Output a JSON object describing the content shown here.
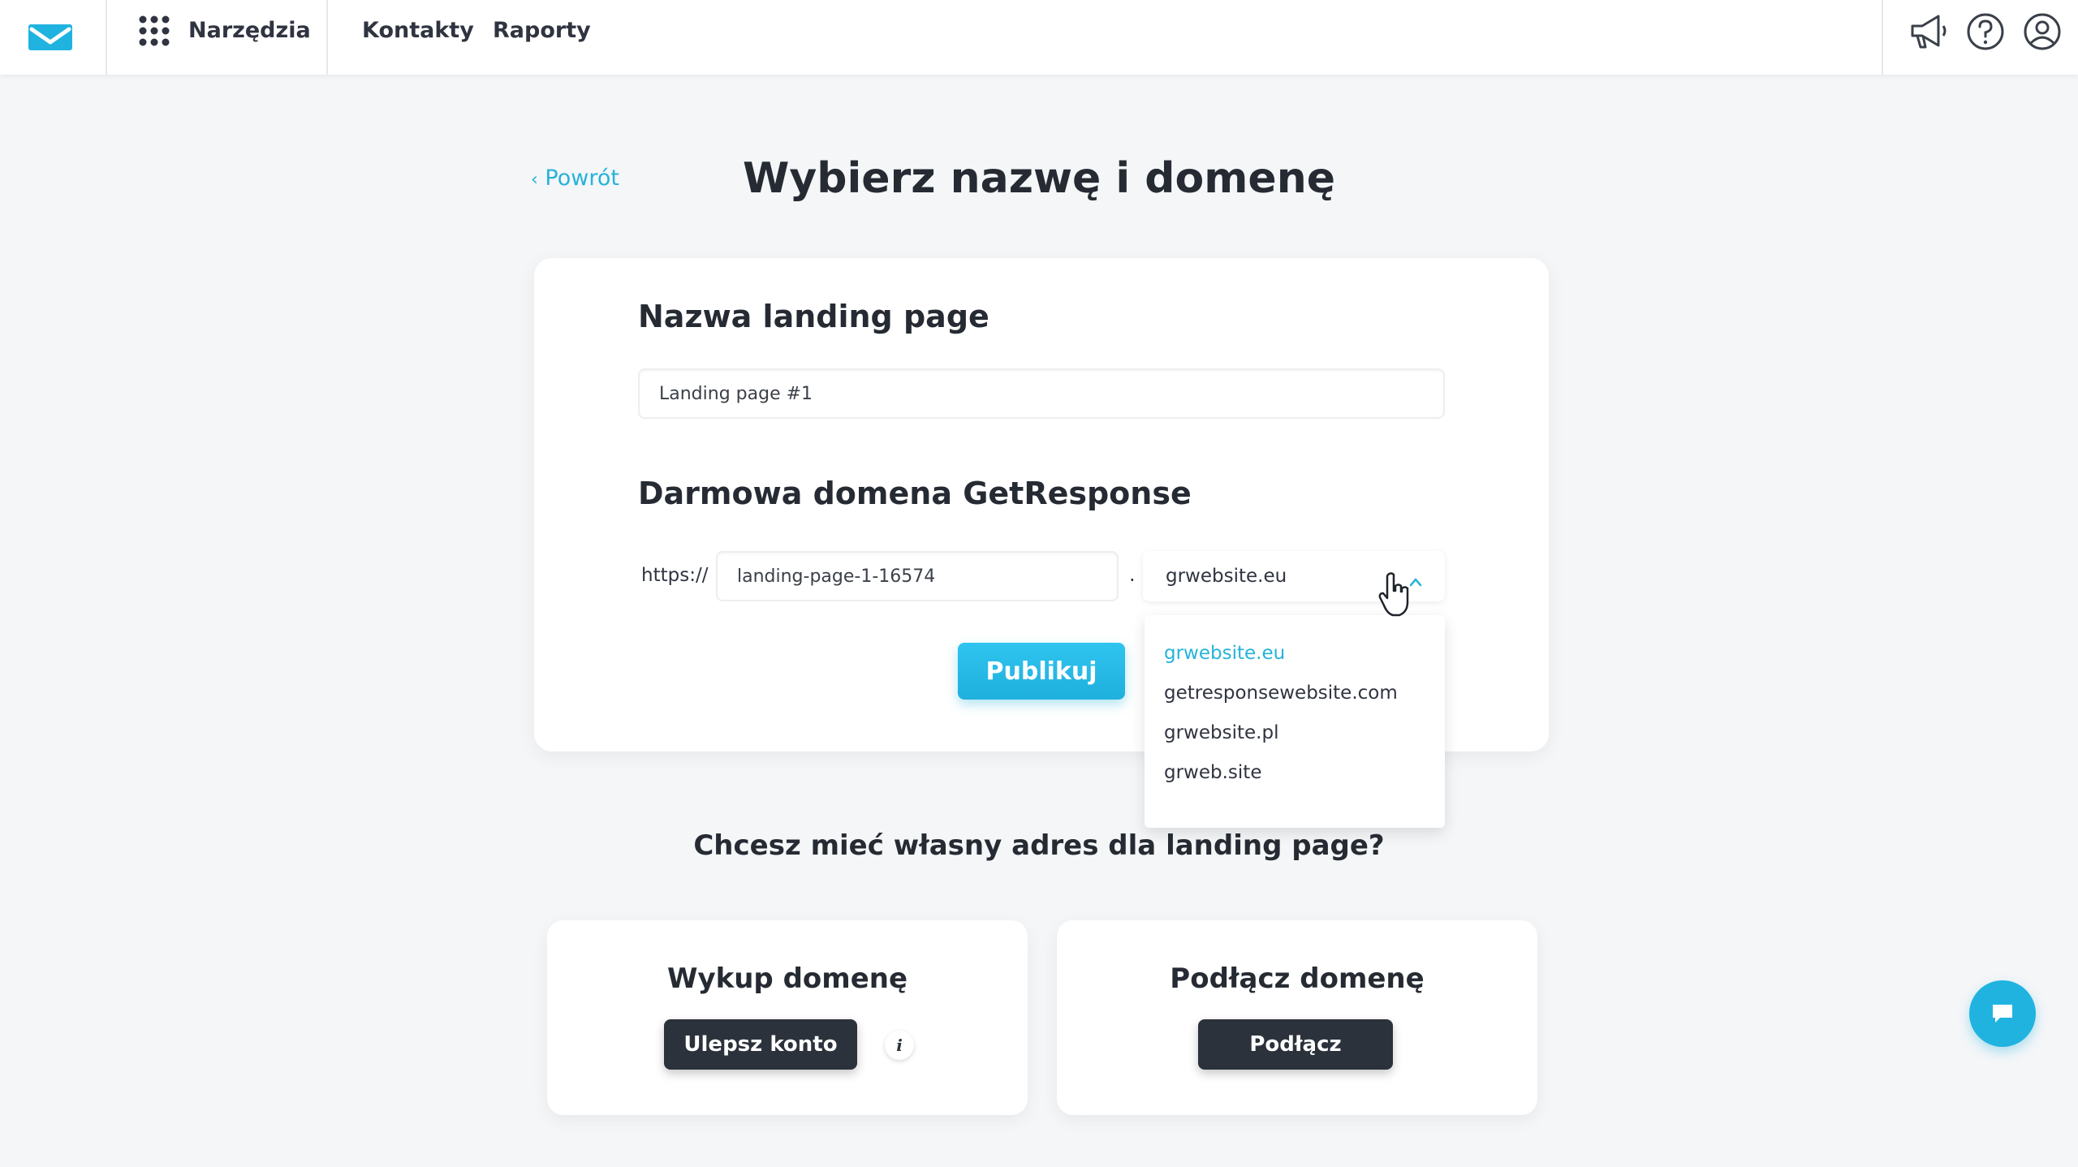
{
  "nav": {
    "tools": "Narzędzia",
    "contacts": "Kontakty",
    "reports": "Raporty",
    "icons": [
      "megaphone-icon",
      "help-icon",
      "user-icon"
    ]
  },
  "header": {
    "back": "Powrót",
    "title": "Wybierz nazwę i domenę"
  },
  "form": {
    "name_title": "Nazwa landing page",
    "name_value": "Landing page #1",
    "domain_title": "Darmowa domena GetResponse",
    "prefix": "https://",
    "subdomain_value": "landing-page-1-16574",
    "dot": ".",
    "selected_domain": "grwebsite.eu",
    "domain_options": [
      "grwebsite.eu",
      "getresponsewebsite.com",
      "grwebsite.pl",
      "grweb.site"
    ],
    "publish": "Publikuj"
  },
  "custom": {
    "question": "Chcesz mieć własny adres dla landing page?",
    "buy_title": "Wykup domenę",
    "buy_button": "Ulepsz konto",
    "info": "i",
    "connect_title": "Podłącz domenę",
    "connect_button": "Podłącz"
  },
  "colors": {
    "accent": "#26b3d9",
    "dark_button": "#2b323b",
    "background": "#f4f6f8"
  }
}
